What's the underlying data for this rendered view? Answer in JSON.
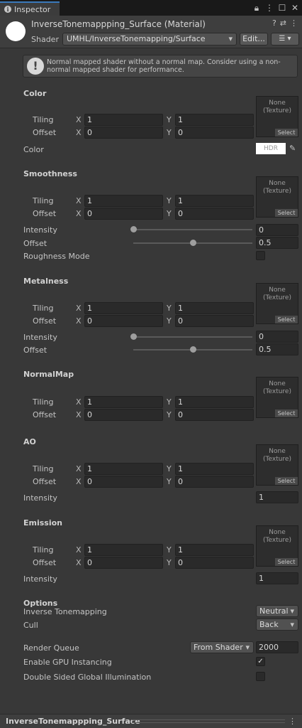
{
  "tab": {
    "label": "Inspector"
  },
  "header": {
    "title": "InverseTonemappping_Surface (Material)",
    "shader_label": "Shader",
    "shader_value": "UMHL/InverseTonemapping/Surface",
    "edit_label": "Edit...",
    "menu_label": "☰ ▾"
  },
  "help": {
    "text": "Normal mapped shader without a normal map. Consider using a non-normal mapped shader for performance."
  },
  "labels": {
    "tiling": "Tiling",
    "offset": "Offset",
    "x": "X",
    "y": "Y",
    "tex_none": "None",
    "tex_type": "(Texture)",
    "tex_select": "Select",
    "intensity": "Intensity",
    "hdr": "HDR"
  },
  "sections": {
    "color": {
      "title": "Color",
      "tiling_x": "1",
      "tiling_y": "1",
      "offset_x": "0",
      "offset_y": "0",
      "color_label": "Color"
    },
    "smoothness": {
      "title": "Smoothness",
      "tiling_x": "1",
      "tiling_y": "1",
      "offset_x": "0",
      "offset_y": "0",
      "intensity": "0",
      "intensity_fraction": 0.0,
      "offset_label": "Offset",
      "offset_value": "0.5",
      "offset_fraction": 0.5,
      "roughness_label": "Roughness Mode",
      "roughness_checked": false
    },
    "metalness": {
      "title": "Metalness",
      "tiling_x": "1",
      "tiling_y": "1",
      "offset_x": "0",
      "offset_y": "0",
      "intensity": "0",
      "intensity_fraction": 0.0,
      "offset_label": "Offset",
      "offset_value": "0.5",
      "offset_fraction": 0.5
    },
    "normalmap": {
      "title": "NormalMap",
      "tiling_x": "1",
      "tiling_y": "1",
      "offset_x": "0",
      "offset_y": "0"
    },
    "ao": {
      "title": "AO",
      "tiling_x": "1",
      "tiling_y": "1",
      "offset_x": "0",
      "offset_y": "0",
      "intensity": "1"
    },
    "emission": {
      "title": "Emission",
      "tiling_x": "1",
      "tiling_y": "1",
      "offset_x": "0",
      "offset_y": "0",
      "intensity": "1"
    }
  },
  "options": {
    "title": "Options",
    "inverse_label": "Inverse Tonemapping",
    "inverse_value": "Neutral",
    "cull_label": "Cull",
    "cull_value": "Back",
    "queue_label": "Render Queue",
    "queue_mode": "From Shader",
    "queue_value": "2000",
    "gpu_label": "Enable GPU Instancing",
    "gpu_checked": true,
    "dsgi_label": "Double Sided Global Illumination",
    "dsgi_checked": false
  },
  "footer": {
    "title": "InverseTonemappping_Surface",
    "menu": "⋮"
  }
}
